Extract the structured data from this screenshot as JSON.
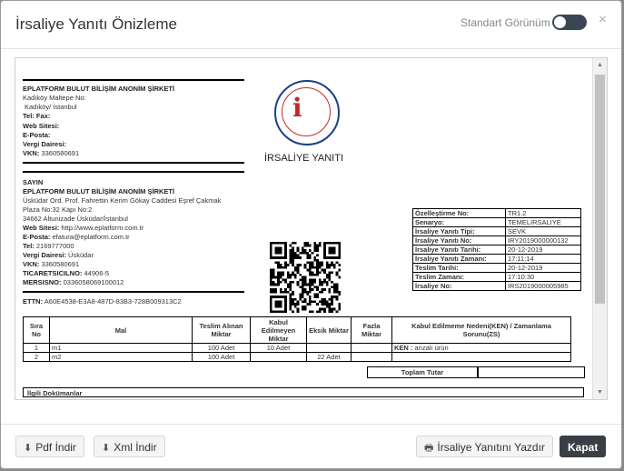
{
  "modal": {
    "title": "İrsaliye Yanıtı Önizleme",
    "view_toggle_label": "Standart Görünüm",
    "close_symbol": "×"
  },
  "sender": {
    "name": "EPLATFORM BULUT BİLİŞİM ANONİM ŞİRKETİ",
    "address_line1": "Kadıköy Maltepe No:",
    "address_line2": "Kadıköy/ İstanbul",
    "tel_fax_label": "Tel: Fax:",
    "web_label": "Web Sitesi:",
    "email_label": "E-Posta:",
    "tax_office_label": "Vergi Dairesi:",
    "vkn_label": "VKN:",
    "vkn": "3360580691"
  },
  "receiver": {
    "heading": "SAYIN",
    "name": "EPLATFORM BULUT BİLİŞİM ANONİM ŞİRKETİ",
    "address_line1": "Üsküdar Ord. Prof. Fahrettin Kerim Gökay Caddesi Eşref Çakmak",
    "address_line2": "Plaza No:32 Kapı No:2",
    "address_line3": "34662 Altunizade Üsküdar/İstanbul",
    "web_label": "Web Sitesi:",
    "web": "http://www.eplatform.com.tr",
    "email_label": "E-Posta:",
    "email": "efatura@eplatform.com.tr",
    "tel_label": "Tel:",
    "tel": "2169777000",
    "tax_office_label": "Vergi Dairesi:",
    "tax_office": "Üsküdar",
    "vkn_label": "VKN:",
    "vkn": "3360580691",
    "trade_reg_label": "TICARETSICILNO:",
    "trade_reg": "44906-5",
    "mersis_label": "MERSISNO:",
    "mersis": "0336058069100012"
  },
  "ettn": {
    "label": "ETTN:",
    "value": "A60E4538-E3A8-487D-83B3-728B009313C2"
  },
  "document_title": "İRSALİYE YANITI",
  "info_table": [
    {
      "key": "Özelleştirme No:",
      "value": "TR1.2"
    },
    {
      "key": "Senaryo:",
      "value": "TEMELIRSALIYE"
    },
    {
      "key": "İrsaliye Yanıtı Tipi:",
      "value": "SEVK"
    },
    {
      "key": "İrsaliye Yanıtı No:",
      "value": "IRY2019000000132"
    },
    {
      "key": "İrsaliye Yanıtı Tarihi:",
      "value": "20-12-2019"
    },
    {
      "key": "İrsaliye Yanıtı Zamanı:",
      "value": "17:11:14"
    },
    {
      "key": "Teslim Tarihi:",
      "value": "20-12-2019"
    },
    {
      "key": "Teslim Zamanı:",
      "value": "17:10:30"
    },
    {
      "key": "İrsaliye No:",
      "value": "IRS2019000005985"
    }
  ],
  "items_table": {
    "headers": [
      "Sıra No",
      "Mal",
      "Teslim Alınan Miktar",
      "Kabul Edilmeyen Miktar",
      "Eksik Miktar",
      "Fazla Miktar",
      "Kabul Edilmeme Nedeni(KEN) / Zamanlama Sorunu(ZS)"
    ],
    "rows": [
      {
        "no": "1",
        "item": "m1",
        "received": "100 Adet",
        "rejected": "10 Adet",
        "missing": "",
        "excess": "",
        "reason_label": "KEN :",
        "reason": "anzalı ürün"
      },
      {
        "no": "2",
        "item": "m2",
        "received": "100 Adet",
        "rejected": "",
        "missing": "22 Adet",
        "excess": "",
        "reason_label": "",
        "reason": ""
      }
    ],
    "total_label": "Toplam Tutar"
  },
  "related_docs_label": "İlgili Dokümanlar",
  "footer": {
    "pdf_label": "Pdf İndir",
    "xml_label": "Xml İndir",
    "print_label": "İrsaliye Yanıtını Yazdır",
    "close_label": "Kapat"
  },
  "colors": {
    "primary_button": "#3a3f45",
    "seal_red": "#c62828",
    "seal_blue": "#1d3f8a"
  }
}
